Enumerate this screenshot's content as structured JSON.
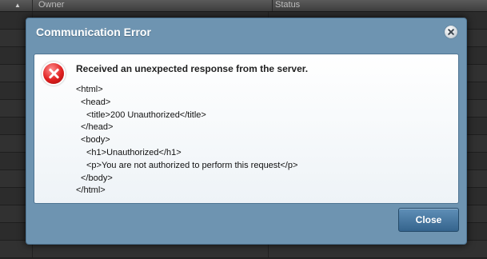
{
  "background_table": {
    "sort_indicator": "▲",
    "columns": [
      "Owner",
      "Status"
    ]
  },
  "dialog": {
    "title": "Communication Error",
    "close_icon": "close-x-icon",
    "headline": "Received an unexpected response from the server.",
    "response_lines": [
      "<html>",
      "<head>",
      "<title>200 Unauthorized</title>",
      "</head>",
      "<body>",
      "<h1>Unauthorized</h1>",
      "<p>You are not authorized to perform this request</p>",
      "</body>",
      "</html>"
    ],
    "close_button_label": "Close"
  },
  "colors": {
    "dialog_bg": "#6e94b1",
    "button": "#4a7aa2",
    "error_red": "#e02020"
  }
}
